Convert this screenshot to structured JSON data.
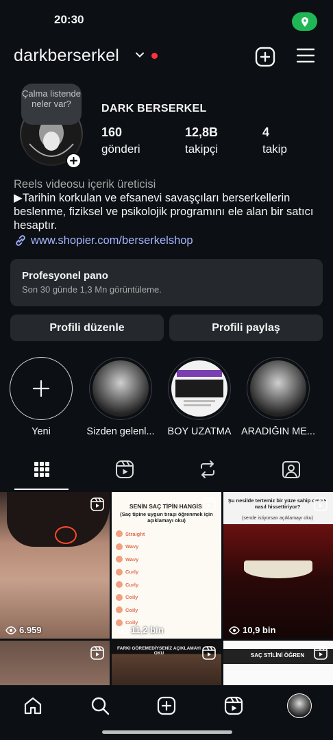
{
  "status": {
    "time": "20:30"
  },
  "header": {
    "username": "darkberserkel"
  },
  "profile": {
    "note": "Çalma listende neler var?",
    "display_name": "DARK BERSERKEL",
    "stats": [
      {
        "value": "160",
        "label": "gönderi"
      },
      {
        "value": "12,8B",
        "label": "takipçi"
      },
      {
        "value": "4",
        "label": "takip"
      }
    ],
    "bio_category": "Reels videosu içerik üreticisi",
    "bio_text": "▶Tarihin korkulan ve efsanevi savaşçıları berserkellerin beslenme, fiziksel ve psikolojik programını ele alan bir satıcı hesaptır.",
    "bio_link": "www.shopier.com/berserkelshop"
  },
  "pro_dashboard": {
    "title": "Profesyonel pano",
    "subtitle": "Son 30 günde 1,3 Mn görüntüleme."
  },
  "buttons": {
    "edit_profile": "Profili düzenle",
    "share_profile": "Profili paylaş"
  },
  "highlights": [
    {
      "label": "Yeni"
    },
    {
      "label": "Sizden gelenl..."
    },
    {
      "label": "BOY UZATMA"
    },
    {
      "label": "ARADIĞIN ME..."
    }
  ],
  "posts": [
    {
      "views": "6.959"
    },
    {
      "views": "11,2 bin",
      "title": "SENİN SAÇ TİPİN HANGİSİ",
      "subtitle": "(Saç tipine uygun tıraşı öğrenmek için açıklamayı oku)",
      "types": [
        "Straight",
        "Wavy",
        "Wavy",
        "Curly",
        "Curly",
        "Coily",
        "Coily",
        "Coily"
      ]
    },
    {
      "views": "10,9 bin",
      "caption": "Şu nesilde tertemiz bir yüze sahip olmak nasıl hissettiriyor?",
      "subcaption": "(sende istiyorsan açıklamayı oku)"
    },
    {
      "views": ""
    },
    {
      "views": "",
      "caption": "FARKI GÖREMEDİYSENİZ AÇIKLAMAYI OKU"
    },
    {
      "views": "",
      "caption": "SAÇ STİLİNİ ÖĞREN"
    }
  ],
  "colors": {
    "background": "#0c1014",
    "card": "#25292e",
    "link": "#a5b4ff",
    "notification": "#ff3040",
    "location": "#1fb655"
  }
}
